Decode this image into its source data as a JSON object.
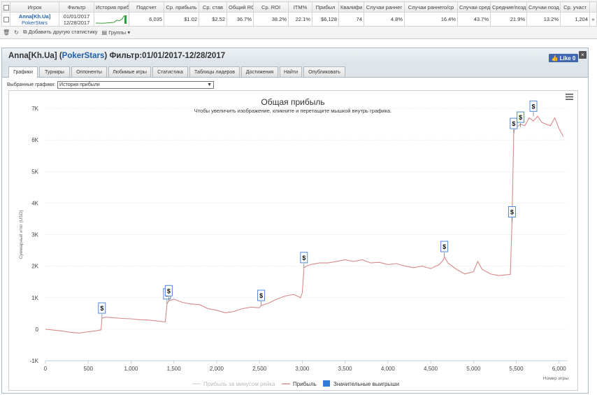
{
  "stats_table": {
    "headers": [
      "Игрок",
      "Фильтр",
      "История приб",
      "Подсчет",
      "Ср. прибыль",
      "Ср. став",
      "Общий RC",
      "Ср. ROI",
      "ITM%",
      "Прибыл",
      "Квалифи",
      "Случаи раннег",
      "Случаи раннего/ср",
      "Случаи сред",
      "Средние/позд",
      "Случаи позд",
      "Ср. участ"
    ],
    "row": {
      "player_name": "Anna[Kh.Ua]",
      "player_site": "PokerStars",
      "filter_from": "01/01/2017",
      "filter_to": "12/28/2017",
      "count": "6,035",
      "avg_profit": "$1.02",
      "avg_stake": "$2.52",
      "total_roi": "36.7%",
      "avg_roi": "38.2%",
      "itm": "22.1%",
      "profit": "$6,128",
      "qualified": "74",
      "early": "4.8%",
      "early_mid": "16.4%",
      "mid": "43.7%",
      "mid_late": "21.9%",
      "late": "13.2%",
      "avg_entrants": "1,204",
      "more": "»"
    }
  },
  "stats_toolbar": {
    "add_stat": "Добавить другую статистику",
    "groups": "Группы"
  },
  "panel": {
    "player": "Anna[Kh.Ua]",
    "site": "PokerStars",
    "filter_label": "Фильтр:01/01/2017-12/28/2017",
    "like_label": "Like 0",
    "close": "×"
  },
  "tabs": [
    "Графики",
    "Турниры",
    "Оппоненты",
    "Любимые игры",
    "Статистика",
    "Таблицы лидеров",
    "Достижения",
    "Найти",
    "Опубликовать"
  ],
  "chart_selector": {
    "label": "Выбранные графики:",
    "value": "История прибыли"
  },
  "colors": {
    "profit_line": "#d98a8a",
    "rake_line": "#d9d9d9",
    "big_wins": "#2f7ed8",
    "link": "#1f5fa8"
  },
  "chart_data": {
    "type": "line",
    "title": "Общая прибыль",
    "subtitle": "Чтобы увеличить изображение, кликните и перетащите мышкой внутрь графика.",
    "xlabel": "Номер игры",
    "ylabel": "Суммарный итог (USD)",
    "xlim": [
      0,
      6100
    ],
    "ylim": [
      -1000,
      7000
    ],
    "x_ticks": [
      0,
      500,
      1000,
      1500,
      2000,
      2500,
      3000,
      3500,
      4000,
      4500,
      5000,
      5500,
      6000
    ],
    "x_tick_labels": [
      "0",
      "500",
      "1,000",
      "1,500",
      "2,000",
      "2,500",
      "3,000",
      "3,500",
      "4,000",
      "4,500",
      "5,000",
      "5,500",
      "6,000"
    ],
    "y_ticks": [
      -1000,
      0,
      1000,
      2000,
      3000,
      4000,
      5000,
      6000,
      7000
    ],
    "y_tick_labels": [
      "-1K",
      "0",
      "1K",
      "2K",
      "3K",
      "4K",
      "5K",
      "6K",
      "7K"
    ],
    "grid": true,
    "legend_position": "bottom",
    "legend": [
      "Прибыль за минусом рейка",
      "Прибыль",
      "Значительные выигрыши"
    ],
    "series": [
      {
        "name": "Прибыль",
        "x": [
          0,
          100,
          200,
          300,
          400,
          500,
          600,
          650,
          660,
          700,
          800,
          900,
          1000,
          1100,
          1200,
          1300,
          1400,
          1420,
          1440,
          1500,
          1600,
          1700,
          1800,
          1900,
          2000,
          2100,
          2200,
          2300,
          2400,
          2500,
          2520,
          2600,
          2700,
          2800,
          2900,
          2980,
          3000,
          3020,
          3050,
          3100,
          3200,
          3300,
          3400,
          3500,
          3600,
          3700,
          3800,
          3900,
          4000,
          4100,
          4200,
          4300,
          4400,
          4500,
          4600,
          4650,
          4660,
          4700,
          4800,
          4900,
          5000,
          5050,
          5100,
          5200,
          5300,
          5400,
          5430,
          5450,
          5470,
          5490,
          5500,
          5550,
          5600,
          5650,
          5700,
          5750,
          5800,
          5850,
          5900,
          5950,
          6000,
          6050
        ],
        "y": [
          0,
          -30,
          -60,
          -100,
          -120,
          -80,
          -50,
          -20,
          350,
          380,
          360,
          340,
          330,
          300,
          290,
          260,
          230,
          800,
          900,
          950,
          850,
          800,
          780,
          650,
          600,
          520,
          560,
          650,
          700,
          680,
          750,
          820,
          950,
          1050,
          1100,
          1000,
          1150,
          1950,
          2000,
          2050,
          2100,
          2100,
          2150,
          2200,
          2150,
          2200,
          2100,
          2120,
          2050,
          2080,
          2000,
          1950,
          2000,
          1920,
          2050,
          2200,
          2300,
          2100,
          1900,
          1750,
          1820,
          2150,
          1900,
          1750,
          1700,
          1730,
          1740,
          3400,
          6200,
          6500,
          6400,
          6500,
          6450,
          6700,
          6600,
          6750,
          6550,
          6500,
          6450,
          6700,
          6350,
          6100
        ]
      }
    ],
    "big_wins": [
      {
        "x": 660,
        "y": 350,
        "label": "$"
      },
      {
        "x": 1420,
        "y": 800,
        "label": "$"
      },
      {
        "x": 1440,
        "y": 900,
        "label": "$"
      },
      {
        "x": 2520,
        "y": 750,
        "label": "$"
      },
      {
        "x": 3020,
        "y": 1950,
        "label": "$"
      },
      {
        "x": 4660,
        "y": 2300,
        "label": "$"
      },
      {
        "x": 5450,
        "y": 3400,
        "label": "$"
      },
      {
        "x": 5470,
        "y": 6200,
        "label": "$"
      },
      {
        "x": 5550,
        "y": 6400,
        "label": "$"
      },
      {
        "x": 5700,
        "y": 6750,
        "label": "$"
      }
    ]
  }
}
